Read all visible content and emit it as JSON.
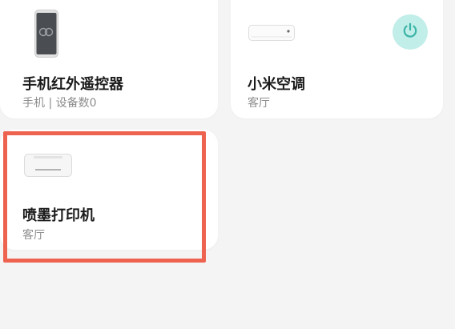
{
  "devices": [
    {
      "name": "手机红外遥控器",
      "sub": "手机 | 设备数0",
      "icon": "phone-icon"
    },
    {
      "name": "小米空调",
      "sub": "客厅",
      "icon": "air-conditioner-icon",
      "power_icon": "power-icon"
    },
    {
      "name": "喷墨打印机",
      "sub": "客厅",
      "icon": "printer-icon"
    }
  ],
  "colors": {
    "highlight": "#ee6350",
    "power_accent": "#3ab4a6",
    "power_bg": "#c2eee9"
  }
}
